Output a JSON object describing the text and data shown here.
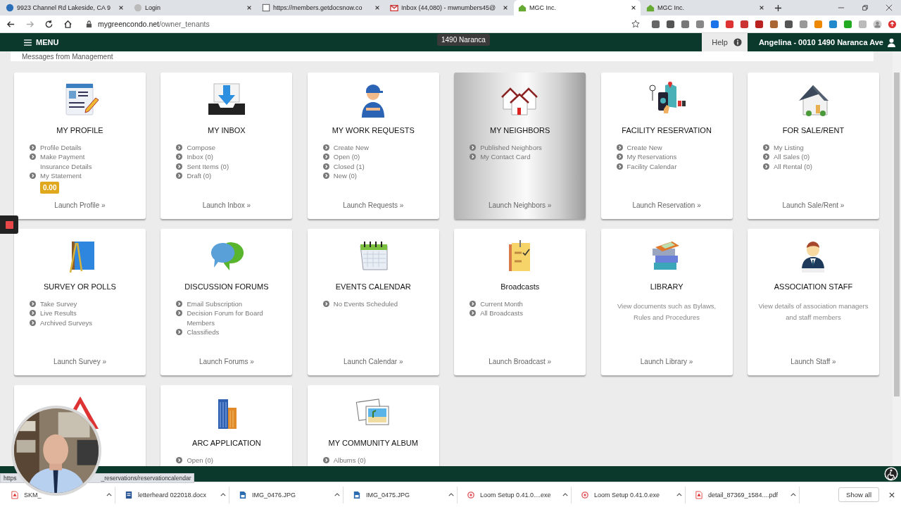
{
  "browser": {
    "tabs": [
      {
        "title": "9923 Channel Rd Lakeside, CA 9",
        "kind": "globe",
        "selected": false
      },
      {
        "title": "Login",
        "kind": "blank",
        "selected": false
      },
      {
        "title": "https://members.getdocsnow.co",
        "kind": "doc",
        "selected": false
      },
      {
        "title": "Inbox (44,080) - mwnumbers45@",
        "kind": "mail",
        "selected": false
      },
      {
        "title": "MGC Inc.",
        "kind": "house",
        "selected": true
      },
      {
        "title": "MGC Inc.",
        "kind": "house",
        "selected": false
      }
    ],
    "address": {
      "host": "mygreencondo.net",
      "path": "/owner_tenants"
    }
  },
  "navbar": {
    "menu": "MENU",
    "tooltip": "1490 Naranca",
    "help": "Help",
    "user": "Angelina - 0010 1490 Naranca Ave"
  },
  "messages_link": "Messages from Management",
  "cards": [
    {
      "title": "MY PROFILE",
      "kind": "profile",
      "highlighted": false,
      "items": [
        {
          "text": "Profile Details",
          "bullet": true
        },
        {
          "text": "Make Payment",
          "bullet": true
        },
        {
          "text": "Insurance Details",
          "bullet": false
        },
        {
          "text": "My Statement",
          "bullet": true
        }
      ],
      "balance": "0.00",
      "launch": "Launch Profile »"
    },
    {
      "title": "MY INBOX",
      "kind": "inbox",
      "highlighted": false,
      "items": [
        {
          "text": "Compose",
          "bullet": true
        },
        {
          "text": "Inbox (0)",
          "bullet": true
        },
        {
          "text": "Sent Items (0)",
          "bullet": true
        },
        {
          "text": "Draft (0)",
          "bullet": true
        }
      ],
      "launch": "Launch Inbox »"
    },
    {
      "title": "MY WORK REQUESTS",
      "kind": "worker",
      "highlighted": false,
      "items": [
        {
          "text": "Create New",
          "bullet": true
        },
        {
          "text": "Open (0)",
          "bullet": true
        },
        {
          "text": "Closed (1)",
          "bullet": true
        },
        {
          "text": "New (0)",
          "bullet": true
        }
      ],
      "launch": "Launch Requests »"
    },
    {
      "title": "MY NEIGHBORS",
      "kind": "houses",
      "highlighted": true,
      "items": [
        {
          "text": "Published Neighbors",
          "bullet": true
        },
        {
          "text": "My Contact Card",
          "bullet": true
        }
      ],
      "launch": "Launch Neighbors »"
    },
    {
      "title": "FACILITY RESERVATION",
      "kind": "map",
      "highlighted": false,
      "items": [
        {
          "text": "Create New",
          "bullet": true
        },
        {
          "text": "My Reservations",
          "bullet": true
        },
        {
          "text": "Facility Calendar",
          "bullet": true
        }
      ],
      "launch": "Launch Reservation »"
    },
    {
      "title": "FOR SALE/RENT",
      "kind": "house",
      "highlighted": false,
      "items": [
        {
          "text": "My Listing",
          "bullet": true
        },
        {
          "text": "All Sales (0)",
          "bullet": true
        },
        {
          "text": "All Rental (0)",
          "bullet": true
        }
      ],
      "launch": "Launch Sale/Rent »"
    },
    {
      "title": "SURVEY OR POLLS",
      "kind": "notebook",
      "highlighted": false,
      "items": [
        {
          "text": "Take Survey",
          "bullet": true
        },
        {
          "text": "Live Results",
          "bullet": true
        },
        {
          "text": "Archived Surveys",
          "bullet": true
        }
      ],
      "launch": "Launch Survey »"
    },
    {
      "title": "DISCUSSION FORUMS",
      "kind": "chat",
      "highlighted": false,
      "items": [
        {
          "text": "Email Subscription",
          "bullet": true
        },
        {
          "text": "Decision Forum for Board Members",
          "bullet": true
        },
        {
          "text": "Classifieds",
          "bullet": true
        }
      ],
      "launch": "Launch Forums »"
    },
    {
      "title": "EVENTS CALENDAR",
      "kind": "calendar",
      "highlighted": false,
      "items": [
        {
          "text": "No Events Scheduled",
          "bullet": true
        }
      ],
      "launch": "Launch Calendar »"
    },
    {
      "title": "Broadcasts",
      "kind": "notes",
      "highlighted": false,
      "items": [
        {
          "text": "Current Month",
          "bullet": true
        },
        {
          "text": "All Broadcasts",
          "bullet": true
        }
      ],
      "launch": "Launch Broadcast »"
    },
    {
      "title": "LIBRARY",
      "kind": "books",
      "highlighted": false,
      "description": "View documents such as Bylaws, Rules and Procedures",
      "launch": "Launch Library »"
    },
    {
      "title": "ASSOCIATION STAFF",
      "kind": "staff",
      "highlighted": false,
      "description": "View details of association managers and staff members",
      "launch": "Launch Staff »"
    },
    {
      "kind": "warning",
      "highlighted": false
    },
    {
      "title": "ARC APPLICATION",
      "kind": "building",
      "highlighted": false,
      "items": [
        {
          "text": "Open (0)",
          "bullet": true
        }
      ]
    },
    {
      "title": "MY COMMUNITY ALBUM",
      "kind": "photos",
      "highlighted": false,
      "items": [
        {
          "text": "Albums (0)",
          "bullet": true
        }
      ]
    }
  ],
  "status_url": [
    "https",
    "_reservations/reservationcalendar"
  ],
  "downloads": {
    "items": [
      {
        "name": "SKM_",
        "kind": "pdf"
      },
      {
        "name": "letterheard 022018.docx",
        "kind": "docx"
      },
      {
        "name": "IMG_0476.JPG",
        "kind": "img"
      },
      {
        "name": "IMG_0475.JPG",
        "kind": "img"
      },
      {
        "name": "Loom Setup 0.41.0....exe",
        "kind": "exe"
      },
      {
        "name": "Loom Setup 0.41.0.exe",
        "kind": "exe"
      },
      {
        "name": "detail_87369_1584....pdf",
        "kind": "pdf"
      }
    ],
    "show_all": "Show all"
  }
}
